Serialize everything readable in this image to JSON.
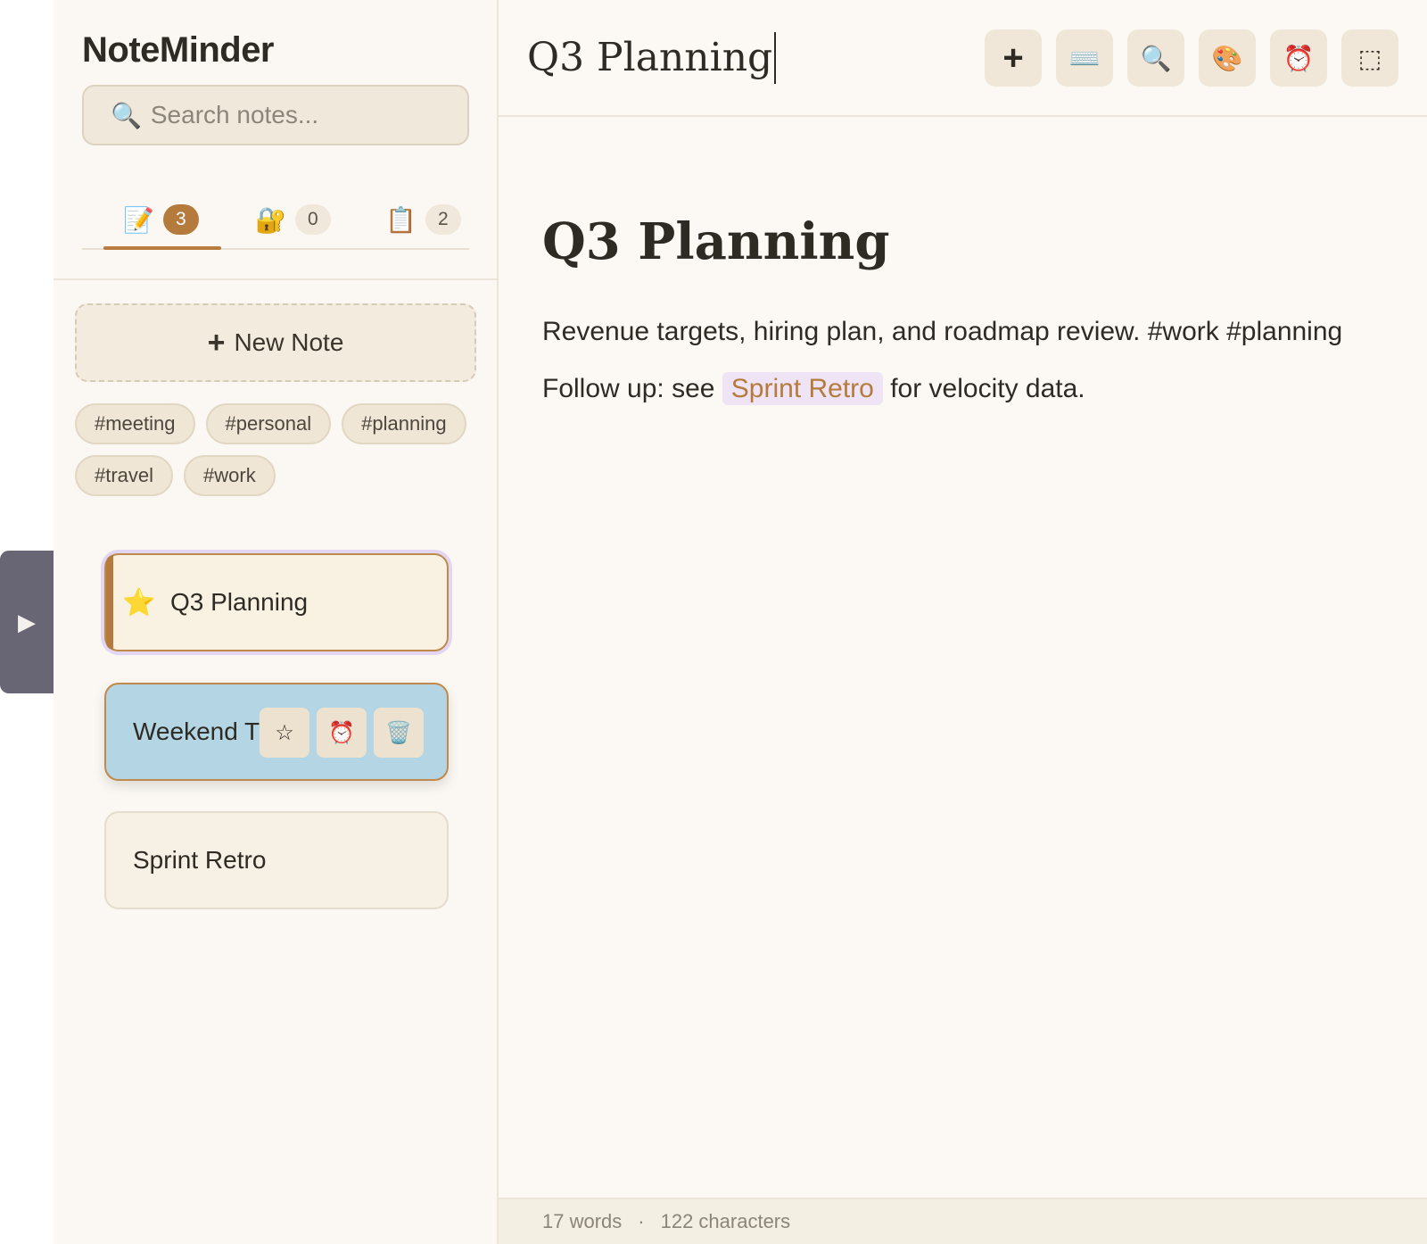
{
  "app": {
    "name": "NoteMinder"
  },
  "search": {
    "placeholder": "Search notes...",
    "icon": "magnifier-icon"
  },
  "tabs": [
    {
      "icon": "📝",
      "name": "notes-tab",
      "count": "3",
      "active": true
    },
    {
      "icon": "🔐",
      "name": "locked-tab",
      "count": "0",
      "active": false
    },
    {
      "icon": "📋",
      "name": "clipboard-tab",
      "count": "2",
      "active": false
    }
  ],
  "sidebar": {
    "new_note_plus": "+",
    "new_note_label": "New Note",
    "tags": [
      "#meeting",
      "#personal",
      "#planning",
      "#travel",
      "#work"
    ],
    "collapse_glyph": "▶"
  },
  "notes": [
    {
      "title": "Q3 Planning",
      "starred_glyph": "⭐"
    },
    {
      "title": "Weekend Trip",
      "actions": [
        "☆",
        "⏰",
        "🗑️"
      ]
    },
    {
      "title": "Sprint Retro"
    }
  ],
  "editor": {
    "title_input": "Q3 Planning",
    "toolbar": [
      "+",
      "⌨️",
      "🔍",
      "🎨",
      "⏰",
      "⬚"
    ],
    "heading": "Q3 Planning",
    "line1": "Revenue targets, hiring plan, and roadmap review. #work #planning",
    "line2_before": "Follow up: see ",
    "line2_link": "Sprint Retro",
    "line2_after": " for velocity data."
  },
  "status": {
    "words": "17 words",
    "separator": "·",
    "characters": "122 characters"
  },
  "colors": {
    "accent": "#b57b3d",
    "background": "#fcf9f4",
    "selected_card_blue": "#b4d6e4",
    "link_bg": "#efe4f5"
  }
}
